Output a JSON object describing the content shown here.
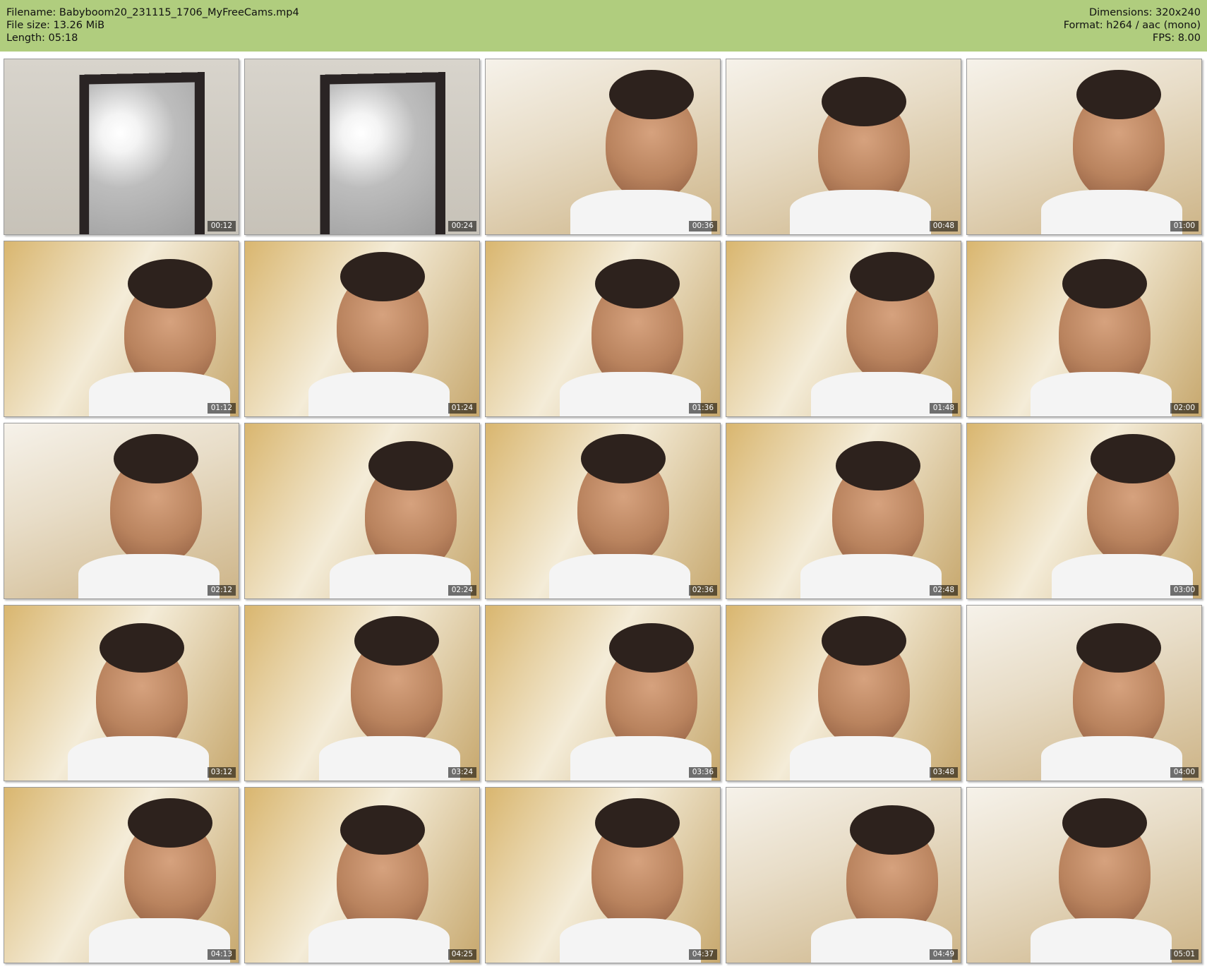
{
  "header": {
    "filename_line": "Filename: Babyboom20_231115_1706_MyFreeCams.mp4",
    "filesize_line": "File size: 13.26 MiB",
    "length_line": "Length: 05:18",
    "dimensions_line": "Dimensions: 320x240",
    "format_line": "Format: h264 / aac (mono)",
    "fps_line": "FPS: 8.00",
    "background_color": "#b0cd7e"
  },
  "thumbnails": [
    {
      "time": "00:12",
      "scene": "room"
    },
    {
      "time": "00:24",
      "scene": "room"
    },
    {
      "time": "00:36",
      "scene": "bright"
    },
    {
      "time": "00:48",
      "scene": "bright"
    },
    {
      "time": "01:00",
      "scene": "bright"
    },
    {
      "time": "01:12",
      "scene": "wall"
    },
    {
      "time": "01:24",
      "scene": "wall"
    },
    {
      "time": "01:36",
      "scene": "wall"
    },
    {
      "time": "01:48",
      "scene": "wall"
    },
    {
      "time": "02:00",
      "scene": "wall"
    },
    {
      "time": "02:12",
      "scene": "bright"
    },
    {
      "time": "02:24",
      "scene": "wall"
    },
    {
      "time": "02:36",
      "scene": "wall"
    },
    {
      "time": "02:48",
      "scene": "wall"
    },
    {
      "time": "03:00",
      "scene": "wall"
    },
    {
      "time": "03:12",
      "scene": "wall"
    },
    {
      "time": "03:24",
      "scene": "wall"
    },
    {
      "time": "03:36",
      "scene": "wall"
    },
    {
      "time": "03:48",
      "scene": "wall"
    },
    {
      "time": "04:00",
      "scene": "bright"
    },
    {
      "time": "04:13",
      "scene": "wall"
    },
    {
      "time": "04:25",
      "scene": "wall"
    },
    {
      "time": "04:37",
      "scene": "wall"
    },
    {
      "time": "04:49",
      "scene": "bright"
    },
    {
      "time": "05:01",
      "scene": "bright"
    }
  ]
}
